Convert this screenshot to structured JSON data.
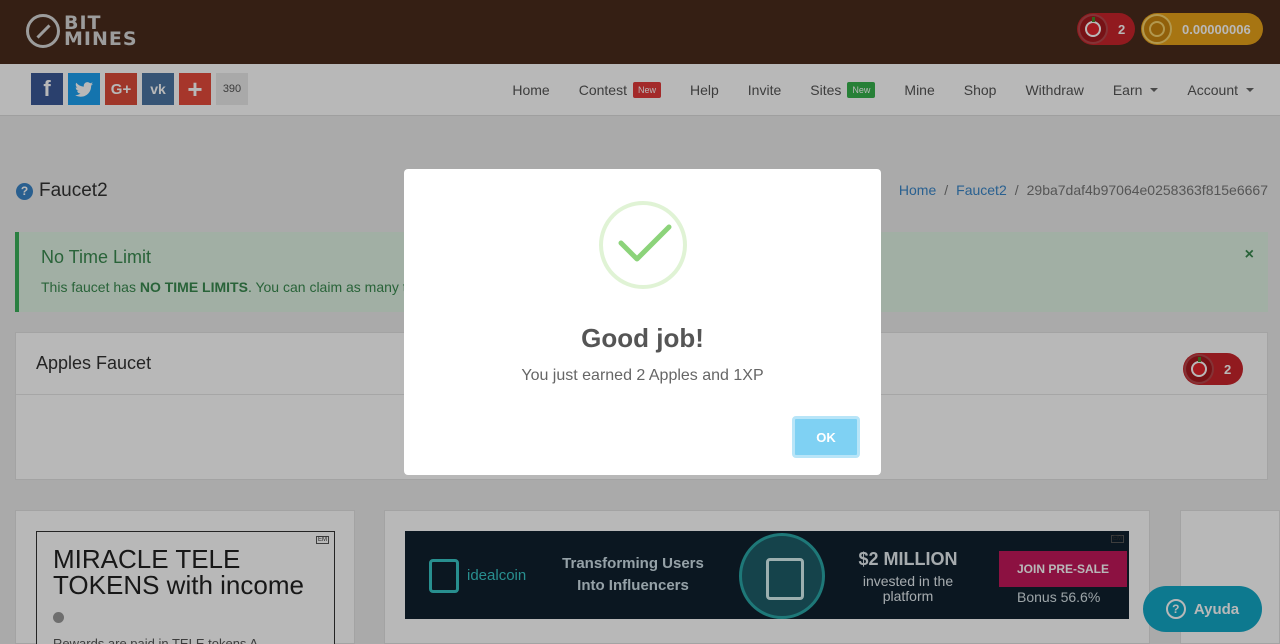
{
  "topbar": {
    "logo_line1": "BIT",
    "logo_line2": "MINES",
    "apples_count": "2",
    "balance": "0.00000006"
  },
  "social": {
    "count": "390",
    "buttons": [
      "f",
      "t",
      "G+",
      "vk",
      "+"
    ]
  },
  "nav": {
    "items": [
      {
        "label": "Home"
      },
      {
        "label": "Contest",
        "badge": "New"
      },
      {
        "label": "Help"
      },
      {
        "label": "Invite"
      },
      {
        "label": "Sites",
        "badge": "New"
      },
      {
        "label": "Mine"
      },
      {
        "label": "Shop"
      },
      {
        "label": "Withdraw"
      },
      {
        "label": "Earn"
      },
      {
        "label": "Account"
      }
    ]
  },
  "page": {
    "title": "Faucet2",
    "breadcrumb": [
      "Home",
      "Faucet2",
      "29ba7daf4b97064e0258363f815e6667"
    ],
    "breadcrumb_sep": "/"
  },
  "alert": {
    "title": "No Time Limit",
    "text_prefix": "This faucet has ",
    "text_bold": "NO TIME LIMITS",
    "text_suffix": ". You can claim as many ti",
    "close": "×"
  },
  "panel": {
    "title": "Apples Faucet",
    "apples_count": "2"
  },
  "ads": {
    "left_title": "MIRACLE TELE\nTOKENS with income",
    "left_sub": "Rewards are paid in TELE tokens A",
    "em_label": "EM",
    "banner_brand": "idealcoin",
    "banner_tagline": "Transforming Users\nInto Influencers",
    "banner_money": "$2 MILLION",
    "banner_money_sub": "invested in the\nplatform",
    "banner_join": "JOIN PRE-SALE",
    "banner_bonus": "Bonus 56.6%"
  },
  "help_button": {
    "label": "Ayuda",
    "icon": "?"
  },
  "modal": {
    "title": "Good job!",
    "text": "You just earned 2 Apples and 1XP",
    "ok_label": "OK"
  },
  "colors": {
    "topbar": "#4a2c1c",
    "apple_red": "#c9252b",
    "coin_gold": "#e8a21a",
    "success_green": "#3bb15a",
    "ok_button": "#7fd1f3",
    "help_teal": "#12a8c7"
  }
}
